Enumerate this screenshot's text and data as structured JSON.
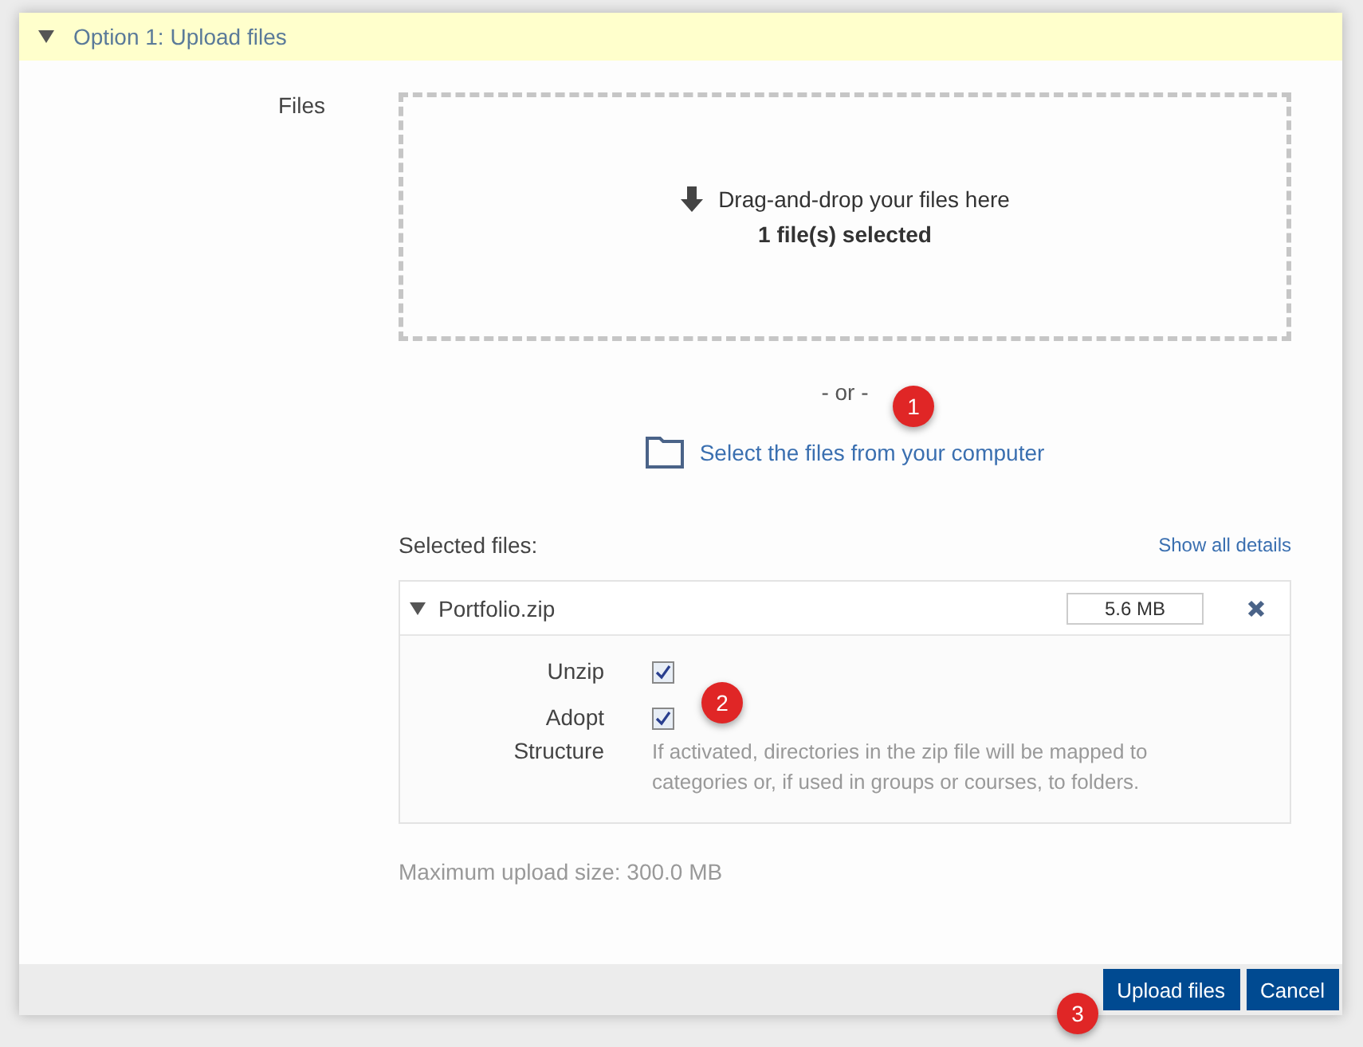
{
  "section": {
    "title": "Option 1: Upload files",
    "expanded": true
  },
  "files_label": "Files",
  "dropzone": {
    "text": "Drag-and-drop your files here",
    "status": "1 file(s) selected"
  },
  "or_text": "- or -",
  "select_link": "Select the files from your computer",
  "selected_files": {
    "label": "Selected files:",
    "details_link": "Show all details"
  },
  "files": [
    {
      "name": "Portfolio.zip",
      "expanded": true,
      "size": "5.6 MB",
      "options": [
        {
          "label": "Unzip",
          "checked": true
        },
        {
          "label": "Adopt Structure",
          "checked": true,
          "hint": "If activated, directories in the zip file will be mapped to categories or, if used in groups or courses, to folders."
        }
      ]
    }
  ],
  "max_size": "Maximum upload size: 300.0 MB",
  "buttons": [
    "Upload files",
    "Cancel"
  ],
  "callouts": [
    "1",
    "2",
    "3"
  ]
}
